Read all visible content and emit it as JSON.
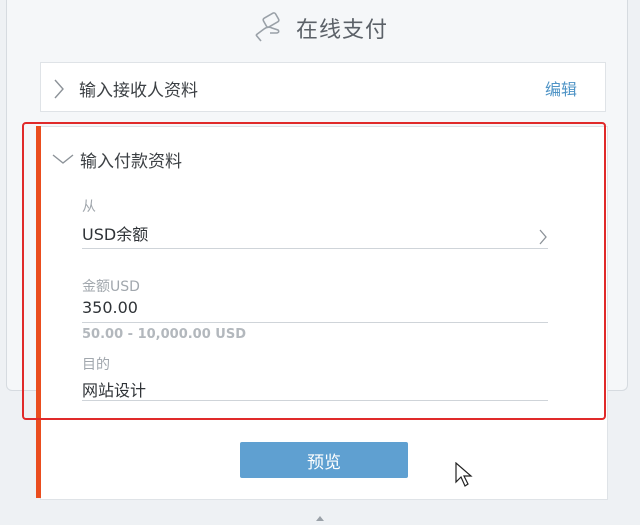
{
  "header": {
    "title": "在线支付",
    "icon": "hand-card-icon"
  },
  "recipient": {
    "label": "输入接收人资料",
    "edit_label": "编辑"
  },
  "payment": {
    "label": "输入付款资料",
    "from": {
      "label": "从",
      "value": "USD余额"
    },
    "amount": {
      "label": "金额USD",
      "value": "350.00",
      "hint": "50.00 - 10,000.00 USD"
    },
    "purpose": {
      "label": "目的",
      "value": "网站设计"
    }
  },
  "actions": {
    "preview_label": "预览"
  },
  "colors": {
    "accent": "#ea4d1e",
    "highlight": "#e02a2a",
    "button": "#5fa0d1",
    "link": "#4f94c6"
  }
}
